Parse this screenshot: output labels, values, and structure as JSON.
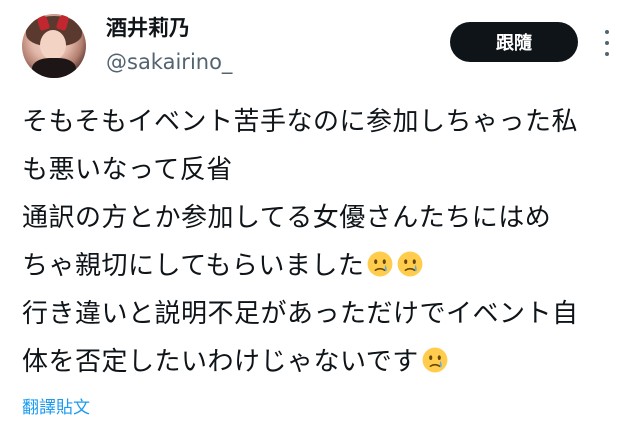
{
  "user": {
    "display_name": "酒井莉乃",
    "handle": "@sakairino_"
  },
  "actions": {
    "follow_label": "跟隨",
    "more_icon": "more-icon"
  },
  "tweet": {
    "lines": [
      "そもそもイベント苦手なのに参加しちゃった私",
      "も悪いなって反省",
      "通訳の方とか参加してる女優さんたちにはめ",
      "ちゃ親切にしてもらいました",
      "行き違いと説明不足があっただけでイベント自",
      "体を否定したいわけじゃないです"
    ],
    "emoji_icon": "face-holding-back-tears-icon"
  },
  "translate": {
    "label": "翻譯貼文"
  },
  "colors": {
    "text": "#0f1419",
    "secondary": "#536471",
    "link": "#1d9bf0",
    "button_bg": "#0f1419",
    "button_text": "#ffffff"
  }
}
